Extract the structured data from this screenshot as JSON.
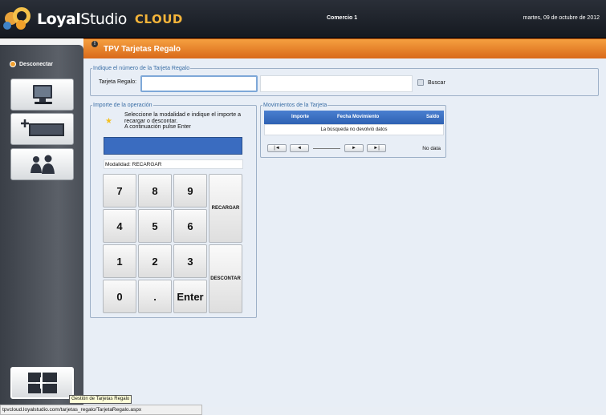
{
  "header": {
    "brand_bold": "Loyal",
    "brand_light": "Studio",
    "brand_cloud": "CLOUD",
    "store": "Comercio 1",
    "date": "martes, 09 de octubre de 2012"
  },
  "sidebar": {
    "disconnect": "Desconectar",
    "buttons": [
      {
        "icon": "monitor-icon"
      },
      {
        "icon": "add-card-icon"
      },
      {
        "icon": "users-icon"
      }
    ],
    "bottom_icon": "gift-card-manager-icon"
  },
  "page": {
    "title": "TPV Tarjetas Regalo"
  },
  "card_section": {
    "legend": "Indique el número de la Tarjeta Regalo",
    "label": "Tarjeta Regalo:",
    "value": "",
    "search": "Buscar"
  },
  "amount_section": {
    "legend": "Importe de la operación",
    "instruction1": "Seleccione la modalidad e indique el importe a recargar o descontar.",
    "instruction2": "A continuación pulse Enter",
    "display_value": "",
    "mode_label": "Modalidad:",
    "mode_value": "RECARGAR",
    "keys": [
      "7",
      "8",
      "9",
      "4",
      "5",
      "6",
      "1",
      "2",
      "3",
      "0",
      ".",
      "Enter"
    ],
    "recharge": "RECARGAR",
    "discount": "DESCONTAR"
  },
  "movements": {
    "legend": "Movimientos de la Tarjeta",
    "columns": [
      "Importe",
      "Fecha Movimiento",
      "Saldo"
    ],
    "empty": "La búsqueda no devolvió datos",
    "pager": {
      "first": "|◄",
      "prev": "◄",
      "next": "►",
      "last": "►|"
    },
    "nodata": "No data"
  },
  "status": {
    "url": "tpvcloud.loyalstudio.com/tarjetas_regalo/TarjetaRegalo.aspx",
    "tooltip": "Gestión de Tarjetas Regalo"
  },
  "colors": {
    "accent": "#f08a2c",
    "grid_header": "#3a6cc0"
  }
}
